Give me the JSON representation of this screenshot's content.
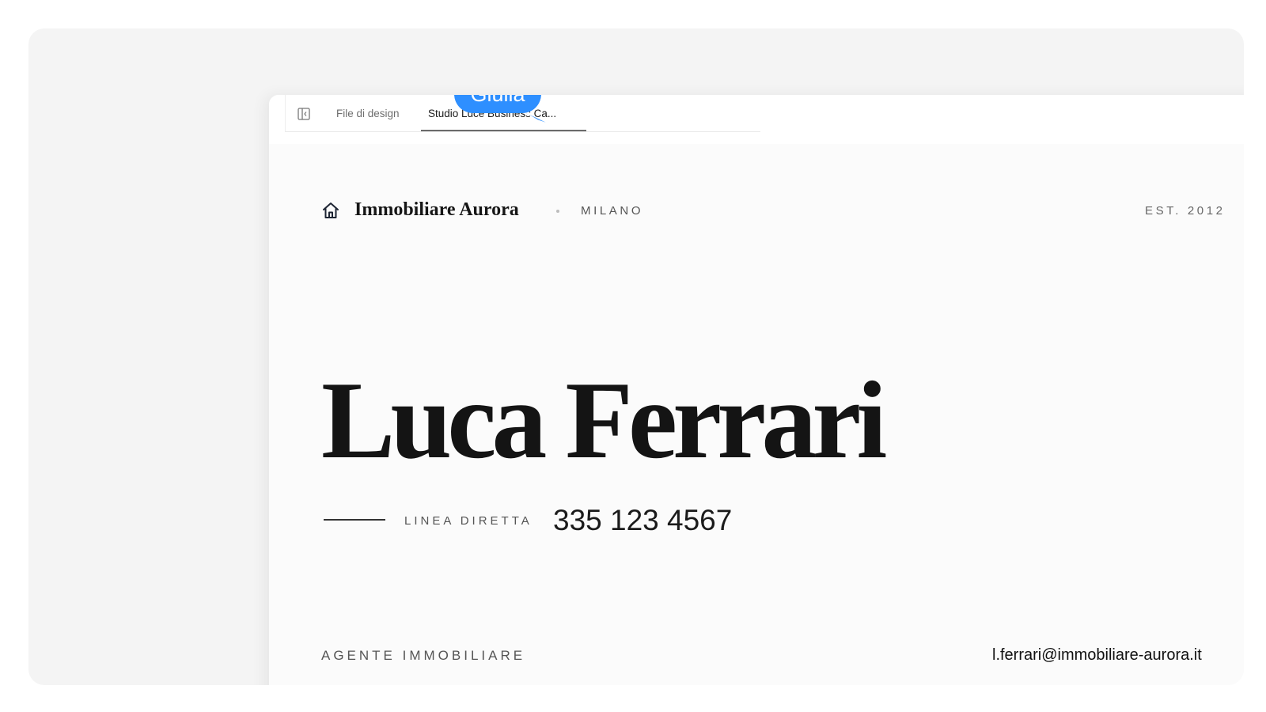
{
  "tabs": {
    "files_label": "File di design",
    "active_label": "Studio Luce Business Ca..."
  },
  "collaborator": {
    "name": "Giulia",
    "color": "#2e8fff"
  },
  "card": {
    "brand_name": "Immobiliare Aurora",
    "city": "MILANO",
    "established": "EST. 2012",
    "agent_name": "Luca Ferrari",
    "phone_label": "LINEA DIRETTA",
    "phone_number": "335 123 4567",
    "role": "AGENTE IMMOBILIARE",
    "email": "l.ferrari@immobiliare-aurora.it"
  },
  "icons": {
    "panel_toggle": "sidebar-toggle-icon",
    "home": "home-icon"
  }
}
